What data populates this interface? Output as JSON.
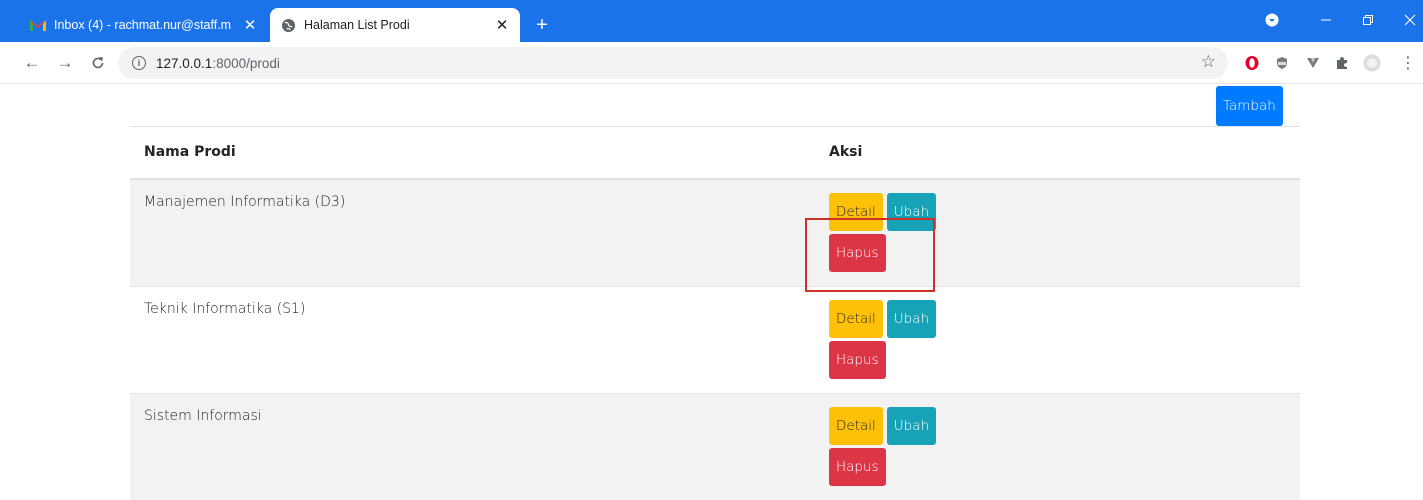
{
  "browser": {
    "tabs": [
      {
        "title": "Inbox (4) - rachmat.nur@staff.m",
        "favicon": "gmail-icon",
        "active": false
      },
      {
        "title": "Halaman List Prodi",
        "favicon": "globe-icon",
        "active": true
      }
    ],
    "new_tab_label": "+",
    "address": {
      "host": "127.0.0.1",
      "path": ":8000/prodi"
    },
    "accent": "#1a73e8"
  },
  "page": {
    "add_button": "Tambah",
    "table": {
      "headers": [
        "Nama Prodi",
        "Aksi"
      ],
      "rows": [
        {
          "name": "Manajemen Informatika (D3)",
          "detail": "Detail",
          "edit": "Ubah",
          "delete": "Hapus"
        },
        {
          "name": "Teknik Informatika (S1)",
          "detail": "Detail",
          "edit": "Ubah",
          "delete": "Hapus"
        },
        {
          "name": "Sistem Informasi",
          "detail": "Detail",
          "edit": "Ubah",
          "delete": "Hapus"
        }
      ]
    },
    "colors": {
      "primary": "#007bff",
      "warning": "#ffc107",
      "info": "#17a2b8",
      "danger": "#dc3545",
      "highlight": "#d0302a"
    }
  }
}
